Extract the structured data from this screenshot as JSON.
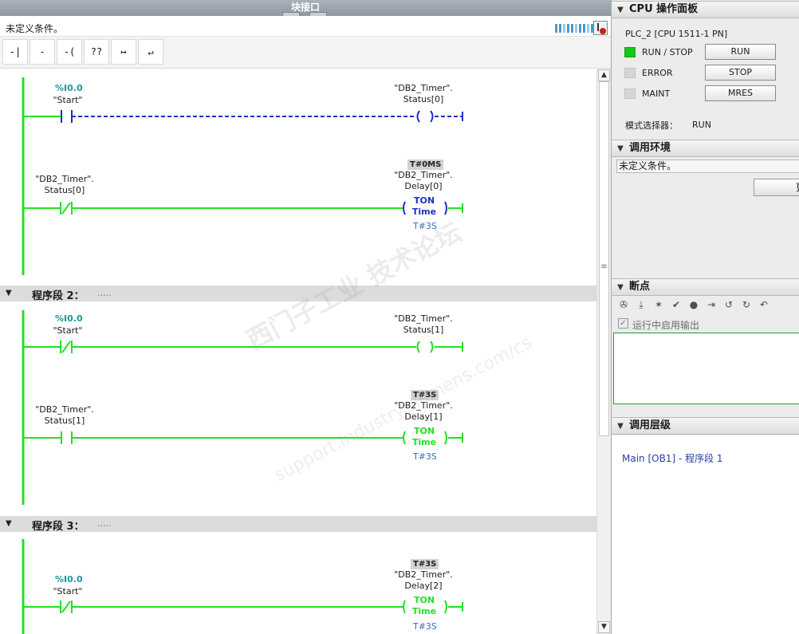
{
  "window": {
    "title": "块接口",
    "condition_text": "未定义条件。"
  },
  "toolbar": {
    "no_contact": "-| |-",
    "nc_contact": "-|/|-",
    "coil": "-( )-",
    "box": "??",
    "branch_open": "↦",
    "branch_close": "↵"
  },
  "network1": {
    "contact1": {
      "address": "%I0.0",
      "name": "\"Start\""
    },
    "coil1": {
      "line1": "\"DB2_Timer\".",
      "line2": "Status[0]"
    },
    "contact2": {
      "line1": "\"DB2_Timer\".",
      "line2": "Status[0]"
    },
    "timer": {
      "tag": "T#0MS",
      "line1": "\"DB2_Timer\".",
      "line2": "Delay[0]",
      "type": "TON",
      "unit": "Time",
      "preset": "T#3S"
    }
  },
  "network2": {
    "header": "程序段 2：",
    "comment": ".....",
    "contact1": {
      "address": "%I0.0",
      "name": "\"Start\""
    },
    "coil1": {
      "line1": "\"DB2_Timer\".",
      "line2": "Status[1]"
    },
    "contact2": {
      "line1": "\"DB2_Timer\".",
      "line2": "Status[1]"
    },
    "timer": {
      "tag": "T#3S",
      "line1": "\"DB2_Timer\".",
      "line2": "Delay[1]",
      "type": "TON",
      "unit": "Time",
      "preset": "T#3S"
    }
  },
  "network3": {
    "header": "程序段 3：",
    "comment": ".....",
    "contact1": {
      "address": "%I0.0",
      "name": "\"Start\""
    },
    "timer": {
      "tag": "T#3S",
      "line1": "\"DB2_Timer\".",
      "line2": "Delay[2]",
      "type": "TON",
      "unit": "Time",
      "preset": "T#3S"
    }
  },
  "watermark": {
    "line1": "西门子工业  技术论坛",
    "line2": "support.industry.siemens.com/cs"
  },
  "cpu_panel": {
    "title": "CPU 操作面板",
    "plc": "PLC_2 [CPU 1511-1 PN]",
    "leds": [
      {
        "label": "RUN / STOP",
        "on": true
      },
      {
        "label": "ERROR",
        "on": false
      },
      {
        "label": "MAINT",
        "on": false
      }
    ],
    "buttons": [
      "RUN",
      "STOP",
      "MRES"
    ],
    "mode_label": "模式选择器：",
    "mode_value": "RUN"
  },
  "call_env": {
    "title": "调用环境",
    "field": "未定义条件。",
    "button": "更"
  },
  "breakpoints": {
    "title": "断点",
    "checkbox_label": "运行中启用输出"
  },
  "call_hierarchy": {
    "title": "调用层级",
    "entry": "Main [OB1] - 程序段 1"
  },
  "colors": {
    "rail_green": "#22e022",
    "ladder_blue": "#1d2fc6",
    "address_teal": "#1a9a96",
    "preset_blue": "#3c6fb5",
    "led_green": "#18c518"
  }
}
